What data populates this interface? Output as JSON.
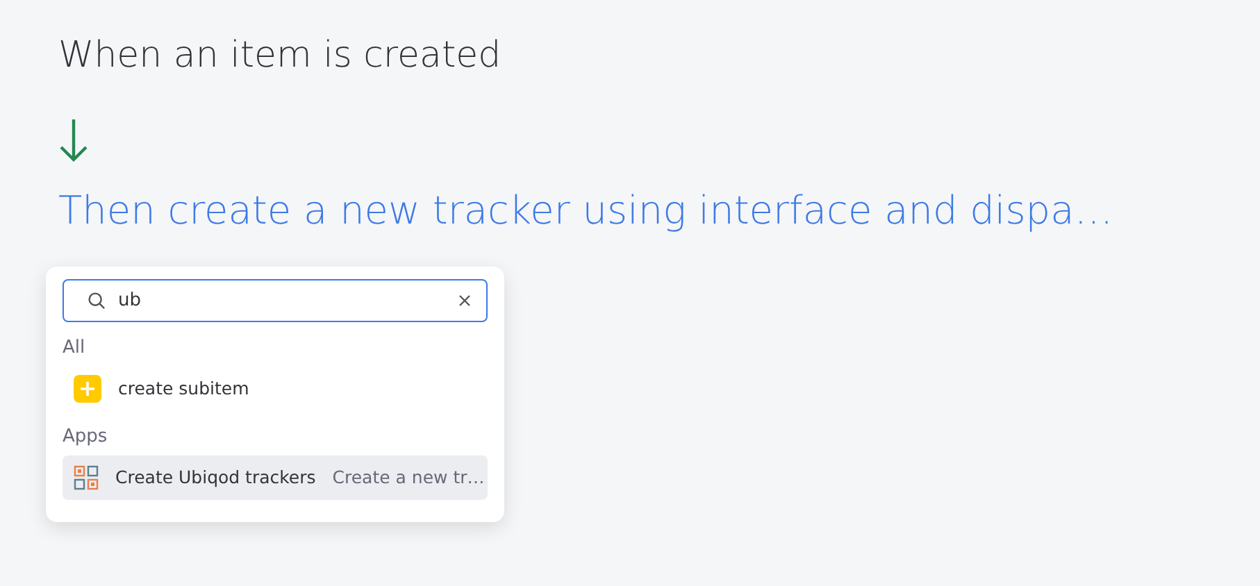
{
  "trigger": "When an item is created",
  "action_title": "Then create a new tracker using interface and dispa…",
  "search": {
    "value": "ub"
  },
  "groups": [
    {
      "label": "All",
      "items": [
        {
          "kind": "action",
          "label": "create subitem",
          "selected": false
        }
      ]
    },
    {
      "label": "Apps",
      "items": [
        {
          "kind": "app",
          "label": "Create Ubiqod trackers",
          "description": "Create a new tr…",
          "selected": true
        }
      ]
    }
  ]
}
